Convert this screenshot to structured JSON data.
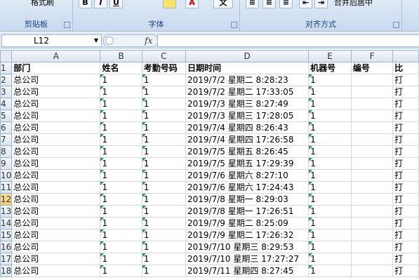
{
  "ribbon": {
    "clipboard": {
      "label": "剪贴板",
      "format_painter": "格式刷"
    },
    "font": {
      "label": "字体",
      "bold": "B",
      "italic": "I",
      "underline": "U",
      "char": "文"
    },
    "alignment": {
      "label": "对齐方式",
      "merge_center": "合并后居中"
    }
  },
  "formula_bar": {
    "name_box": "L12",
    "fx": "fx",
    "formula": ""
  },
  "columns": [
    "A",
    "B",
    "C",
    "D",
    "E",
    "F",
    ""
  ],
  "rows": [
    {
      "num": "1",
      "cells": [
        "部门",
        "姓名",
        "考勤号码",
        "日期时间",
        "机器号",
        "编号",
        "比"
      ]
    },
    {
      "num": "2",
      "cells": [
        "总公司",
        "1",
        "1",
        "2019/7/2 星期二 8:28:23",
        "1",
        "",
        "打"
      ]
    },
    {
      "num": "3",
      "cells": [
        "总公司",
        "1",
        "1",
        "2019/7/2 星期二 17:33:05",
        "1",
        "",
        "打"
      ]
    },
    {
      "num": "4",
      "cells": [
        "总公司",
        "1",
        "1",
        "2019/7/3 星期三 8:27:49",
        "1",
        "",
        "打"
      ]
    },
    {
      "num": "5",
      "cells": [
        "总公司",
        "1",
        "1",
        "2019/7/3 星期三 17:28:05",
        "1",
        "",
        "打"
      ]
    },
    {
      "num": "6",
      "cells": [
        "总公司",
        "1",
        "1",
        "2019/7/4 星期四 8:26:43",
        "1",
        "",
        "打"
      ]
    },
    {
      "num": "7",
      "cells": [
        "总公司",
        "1",
        "1",
        "2019/7/4 星期四 17:26:58",
        "1",
        "",
        "打"
      ]
    },
    {
      "num": "8",
      "cells": [
        "总公司",
        "1",
        "1",
        "2019/7/5 星期五 8:26:45",
        "1",
        "",
        "打"
      ]
    },
    {
      "num": "9",
      "cells": [
        "总公司",
        "1",
        "1",
        "2019/7/5 星期五 17:29:39",
        "1",
        "",
        "打"
      ]
    },
    {
      "num": "10",
      "cells": [
        "总公司",
        "1",
        "1",
        "2019/7/6 星期六 8:27:10",
        "1",
        "",
        "打"
      ]
    },
    {
      "num": "11",
      "cells": [
        "总公司",
        "1",
        "1",
        "2019/7/6 星期六 17:24:43",
        "1",
        "",
        "打"
      ]
    },
    {
      "num": "12",
      "cells": [
        "总公司",
        "1",
        "1",
        "2019/7/8 星期一 8:29:03",
        "1",
        "",
        "打"
      ]
    },
    {
      "num": "13",
      "cells": [
        "总公司",
        "1",
        "1",
        "2019/7/8 星期一 17:26:51",
        "1",
        "",
        "打"
      ]
    },
    {
      "num": "14",
      "cells": [
        "总公司",
        "1",
        "1",
        "2019/7/9 星期二 8:25:09",
        "1",
        "",
        "打"
      ]
    },
    {
      "num": "15",
      "cells": [
        "总公司",
        "1",
        "1",
        "2019/7/9 星期二 17:26:32",
        "1",
        "",
        "打"
      ]
    },
    {
      "num": "16",
      "cells": [
        "总公司",
        "1",
        "1",
        "2019/7/10 星期三 8:29:53",
        "1",
        "",
        "打"
      ]
    },
    {
      "num": "17",
      "cells": [
        "总公司",
        "1",
        "1",
        "2019/7/10 星期三 17:27:27",
        "1",
        "",
        "打"
      ]
    },
    {
      "num": "18",
      "cells": [
        "总公司",
        "1",
        "1",
        "2019/7/11 星期四 8:27:45",
        "1",
        "",
        "打"
      ]
    }
  ],
  "active_row": "12",
  "colors": {
    "indicator": "#1e9a3a",
    "active_header": "#f6c765"
  }
}
